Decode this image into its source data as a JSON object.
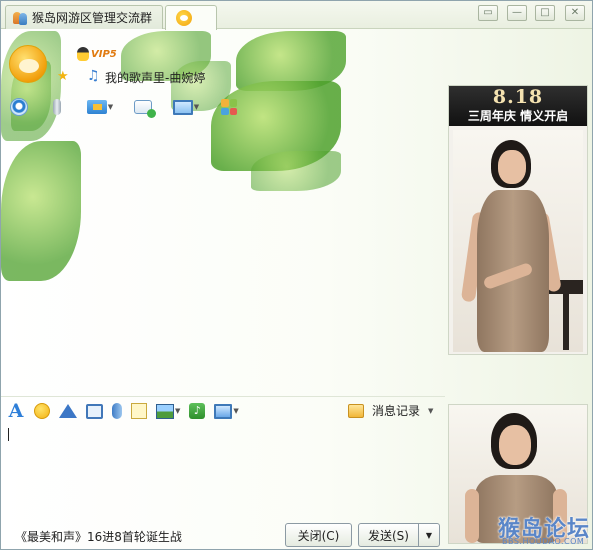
{
  "window": {
    "tabs": [
      {
        "label": "猴岛网游区管理交流群",
        "icon": "group-icon"
      },
      {
        "label": "",
        "icon": "penguin-icon"
      }
    ],
    "controls": {
      "skin": "▭",
      "minimize": "—",
      "maximize": "□",
      "close": "✕"
    }
  },
  "profile": {
    "vip_label": "VIP5",
    "star": "★",
    "signature": "我的歌声里-曲婉婷"
  },
  "ad_top": {
    "big": "8.18",
    "small": "三周年庆 情义开启"
  },
  "composer": {
    "history_label": "消息记录",
    "drop": "▼"
  },
  "watermark": {
    "title": "猴岛论坛",
    "url": "BBS.HOUDAO.COM"
  },
  "footer": {
    "status_text": "《最美和声》16进8首轮诞生战",
    "close_label": "关闭(C)",
    "send_label": "发送(S)",
    "send_drop": "▼"
  },
  "colors": {
    "accent": "#2f7fd8",
    "leaf": "#4ea12c"
  }
}
